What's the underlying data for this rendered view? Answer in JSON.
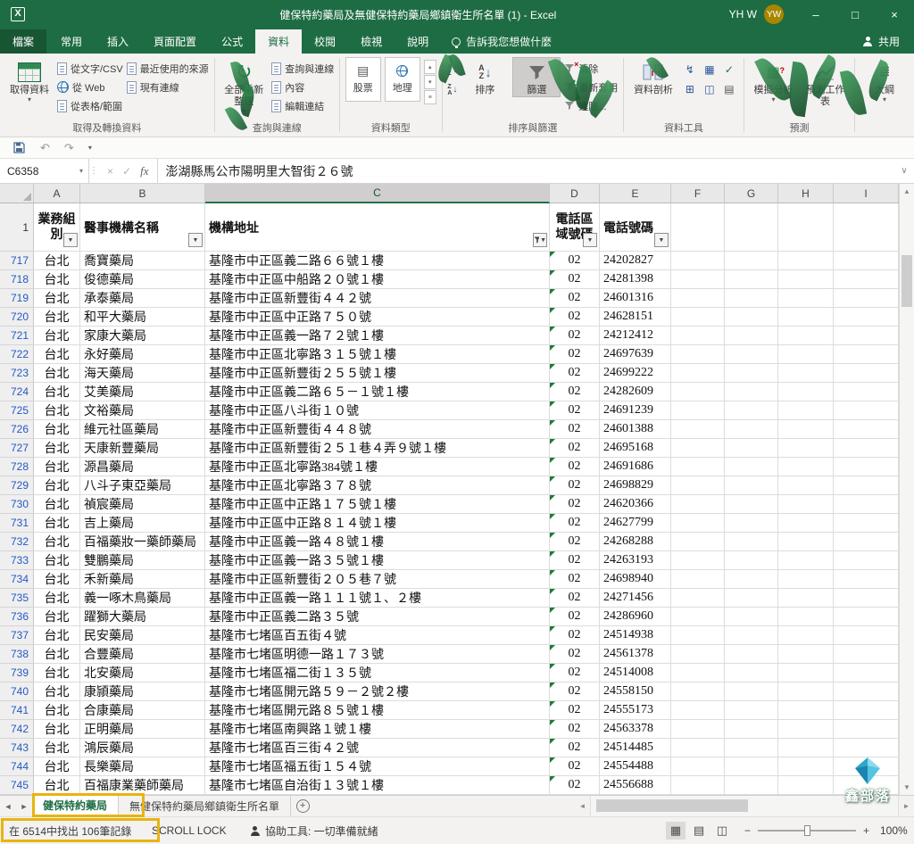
{
  "titlebar": {
    "title": "健保特約藥局及無健保特約藥局鄉鎮衛生所名單 (1) - Excel",
    "user_name": "YH W",
    "avatar_initials": "YW",
    "minimize": "–",
    "maximize": "□",
    "close": "×"
  },
  "ribbon": {
    "tabs": [
      {
        "label": "檔案"
      },
      {
        "label": "常用"
      },
      {
        "label": "插入"
      },
      {
        "label": "頁面配置"
      },
      {
        "label": "公式"
      },
      {
        "label": "資料"
      },
      {
        "label": "校閱"
      },
      {
        "label": "檢視"
      },
      {
        "label": "說明"
      }
    ],
    "tell_me": "告訴我您想做什麼",
    "share_label": "共用",
    "groups": {
      "get_transform": {
        "label": "取得及轉換資料",
        "get_data": "取得資料",
        "from_text_csv": "從文字/CSV",
        "from_web": "從 Web",
        "from_table": "從表格/範圍",
        "recent_sources": "最近使用的來源",
        "existing_connections": "現有連線"
      },
      "queries": {
        "label": "查詢與連線",
        "refresh_all": "全部重新整理",
        "queries_connections": "查詢與連線",
        "properties": "內容",
        "edit_links": "編輯連結"
      },
      "data_types": {
        "label": "資料類型",
        "stocks": "股票",
        "geography": "地理"
      },
      "sort_filter": {
        "label": "排序與篩選",
        "sort": "排序",
        "filter": "篩選",
        "clear": "清除",
        "reapply": "重新套用",
        "advanced": "進階..."
      },
      "data_tools": {
        "label": "資料工具",
        "text_to_columns": "資料剖析"
      },
      "forecast": {
        "label": "預測",
        "what_if": "模擬分析",
        "forecast_sheet": "預測工作表"
      },
      "outline": {
        "label": "大綱"
      }
    }
  },
  "formula_bar": {
    "name_box": "C6358",
    "fx": "fx",
    "content": "澎湖縣馬公市陽明里大智街２６號"
  },
  "grid": {
    "column_letters": [
      "A",
      "B",
      "C",
      "D",
      "E",
      "F",
      "G",
      "H",
      "I"
    ],
    "selected_column": "C",
    "header_row": {
      "row_num": "1",
      "a": "業務組別",
      "b": "醫事機構名稱",
      "c": "機構地址",
      "d": "電話區域號碼",
      "e": "電話號碼"
    },
    "rows": [
      {
        "n": "717",
        "area": "台北",
        "name": "喬寶藥局",
        "addr": "基隆市中正區義二路６６號１樓",
        "code": "02",
        "phone": "24202827"
      },
      {
        "n": "718",
        "area": "台北",
        "name": "俊德藥局",
        "addr": "基隆市中正區中船路２０號１樓",
        "code": "02",
        "phone": "24281398"
      },
      {
        "n": "719",
        "area": "台北",
        "name": "承泰藥局",
        "addr": "基隆市中正區新豐街４４２號",
        "code": "02",
        "phone": "24601316"
      },
      {
        "n": "720",
        "area": "台北",
        "name": "和平大藥局",
        "addr": "基隆市中正區中正路７５０號",
        "code": "02",
        "phone": "24628151"
      },
      {
        "n": "721",
        "area": "台北",
        "name": "家康大藥局",
        "addr": "基隆市中正區義一路７２號１樓",
        "code": "02",
        "phone": "24212412"
      },
      {
        "n": "722",
        "area": "台北",
        "name": "永好藥局",
        "addr": "基隆市中正區北寧路３１５號１樓",
        "code": "02",
        "phone": "24697639"
      },
      {
        "n": "723",
        "area": "台北",
        "name": "海天藥局",
        "addr": "基隆市中正區新豐街２５５號１樓",
        "code": "02",
        "phone": "24699222"
      },
      {
        "n": "724",
        "area": "台北",
        "name": "艾美藥局",
        "addr": "基隆市中正區義二路６５－１號１樓",
        "code": "02",
        "phone": "24282609"
      },
      {
        "n": "725",
        "area": "台北",
        "name": "文裕藥局",
        "addr": "基隆市中正區八斗街１０號",
        "code": "02",
        "phone": "24691239"
      },
      {
        "n": "726",
        "area": "台北",
        "name": "維元社區藥局",
        "addr": "基隆市中正區新豐街４４８號",
        "code": "02",
        "phone": "24601388"
      },
      {
        "n": "727",
        "area": "台北",
        "name": "天康新豐藥局",
        "addr": "基隆市中正區新豐街２５１巷４弄９號１樓",
        "code": "02",
        "phone": "24695168"
      },
      {
        "n": "728",
        "area": "台北",
        "name": "源昌藥局",
        "addr": "基隆市中正區北寧路384號１樓",
        "code": "02",
        "phone": "24691686"
      },
      {
        "n": "729",
        "area": "台北",
        "name": "八斗子東亞藥局",
        "addr": "基隆市中正區北寧路３７８號",
        "code": "02",
        "phone": "24698829"
      },
      {
        "n": "730",
        "area": "台北",
        "name": "禎宸藥局",
        "addr": "基隆市中正區中正路１７５號１樓",
        "code": "02",
        "phone": "24620366"
      },
      {
        "n": "731",
        "area": "台北",
        "name": "吉上藥局",
        "addr": "基隆市中正區中正路８１４號１樓",
        "code": "02",
        "phone": "24627799"
      },
      {
        "n": "732",
        "area": "台北",
        "name": "百福藥妝一藥師藥局",
        "addr": "基隆市中正區義一路４８號１樓",
        "code": "02",
        "phone": "24268288"
      },
      {
        "n": "733",
        "area": "台北",
        "name": "雙鵬藥局",
        "addr": "基隆市中正區義一路３５號１樓",
        "code": "02",
        "phone": "24263193"
      },
      {
        "n": "734",
        "area": "台北",
        "name": "禾新藥局",
        "addr": "基隆市中正區新豐街２０５巷７號",
        "code": "02",
        "phone": "24698940"
      },
      {
        "n": "735",
        "area": "台北",
        "name": "義一啄木鳥藥局",
        "addr": "基隆市中正區義一路１１１號１、２樓",
        "code": "02",
        "phone": "24271456"
      },
      {
        "n": "736",
        "area": "台北",
        "name": "躍獅大藥局",
        "addr": "基隆市中正區義二路３５號",
        "code": "02",
        "phone": "24286960"
      },
      {
        "n": "737",
        "area": "台北",
        "name": "民安藥局",
        "addr": "基隆市七堵區百五街４號",
        "code": "02",
        "phone": "24514938"
      },
      {
        "n": "738",
        "area": "台北",
        "name": "合豐藥局",
        "addr": "基隆市七堵區明德一路１７３號",
        "code": "02",
        "phone": "24561378"
      },
      {
        "n": "739",
        "area": "台北",
        "name": "北安藥局",
        "addr": "基隆市七堵區福二街１３５號",
        "code": "02",
        "phone": "24514008"
      },
      {
        "n": "740",
        "area": "台北",
        "name": "康頴藥局",
        "addr": "基隆市七堵區開元路５９－２號２樓",
        "code": "02",
        "phone": "24558150"
      },
      {
        "n": "741",
        "area": "台北",
        "name": "合康藥局",
        "addr": "基隆市七堵區開元路８５號１樓",
        "code": "02",
        "phone": "24555173"
      },
      {
        "n": "742",
        "area": "台北",
        "name": "正明藥局",
        "addr": "基隆市七堵區南興路１號１樓",
        "code": "02",
        "phone": "24563378"
      },
      {
        "n": "743",
        "area": "台北",
        "name": "鴻辰藥局",
        "addr": "基隆市七堵區百三街４２號",
        "code": "02",
        "phone": "24514485"
      },
      {
        "n": "744",
        "area": "台北",
        "name": "長樂藥局",
        "addr": "基隆市七堵區福五街１５４號",
        "code": "02",
        "phone": "24554488"
      },
      {
        "n": "745",
        "area": "台北",
        "name": "百福康業藥師藥局",
        "addr": "基隆市七堵區自治街１３號１樓",
        "code": "02",
        "phone": "24556688"
      }
    ]
  },
  "sheets": {
    "tab1": "健保特約藥局",
    "tab2": "無健保特約藥局鄉鎮衛生所名單"
  },
  "status_bar": {
    "filter_result": "在 6514中找出 106筆記錄",
    "scroll_lock": "SCROLL LOCK",
    "accessibility": "協助工具: 一切準備就緒",
    "zoom": "100%"
  },
  "watermark": {
    "text": "鑫部落"
  },
  "colors": {
    "excel_green": "#217346",
    "titlebar_green": "#1e6c43",
    "annotation_yellow": "#e8b410",
    "filtered_row_blue": "#2458c5",
    "error_triangle_green": "#1e7a3c"
  }
}
